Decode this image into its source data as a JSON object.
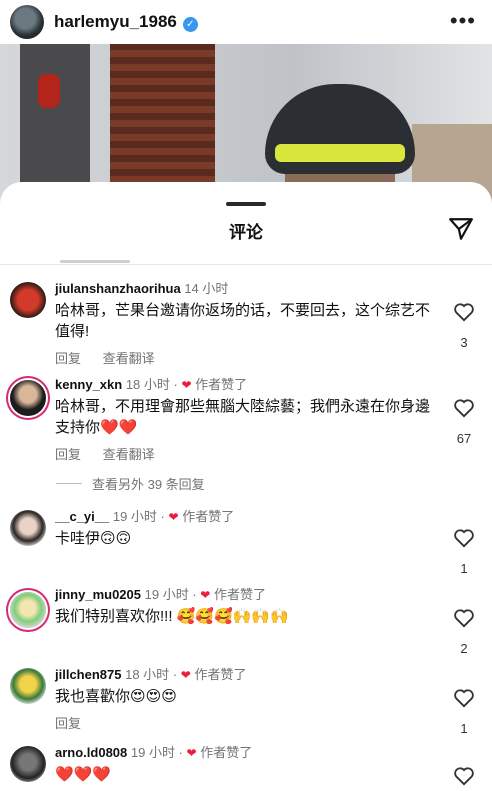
{
  "post": {
    "username": "harlemyu_1986",
    "verified_mark": "✓",
    "more": "•••"
  },
  "sheet": {
    "title": "评论"
  },
  "comments": [
    {
      "user": "jiulanshanzhaorihua",
      "time": "14 小时",
      "liked_by_author": "",
      "text": "哈林哥，芒果台邀请你返场的话，不要回去，这个综艺不值得!",
      "reply": "回复",
      "translate": "查看翻译",
      "likes": "3"
    },
    {
      "user": "kenny_xkn",
      "time": "18 小时",
      "liked_by_author": "作者赞了",
      "text": "哈林哥，不用理會那些無腦大陸綜藝；我們永遠在你身邊支持你❤️❤️",
      "reply": "回复",
      "translate": "查看翻译",
      "likes": "67"
    },
    {
      "user": "__c_yi__",
      "time": "19 小时",
      "liked_by_author": "作者赞了",
      "text": "卡哇伊🙃🙃",
      "likes": "1"
    },
    {
      "user": "jinny_mu0205",
      "time": "19 小时",
      "liked_by_author": "作者赞了",
      "text": "我们特别喜欢你!!! 🥰🥰🥰🙌🙌🙌",
      "likes": "2"
    },
    {
      "user": "jillchen875",
      "time": "18 小时",
      "liked_by_author": "作者赞了",
      "text": "我也喜歡你😍😍😍",
      "reply": "回复",
      "likes": "1"
    },
    {
      "user": "arno.ld0808",
      "time": "19 小时",
      "liked_by_author": "作者赞了",
      "text": "❤️❤️❤️"
    }
  ],
  "view_more_replies": "查看另外 39 条回复",
  "icons": {
    "like": "heart-outline-icon",
    "send": "send-icon",
    "author_like": "heart-filled-icon"
  }
}
